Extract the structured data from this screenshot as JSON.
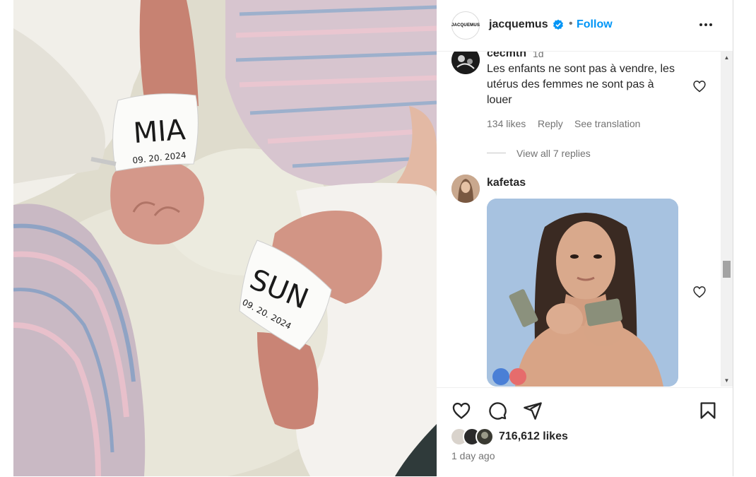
{
  "post": {
    "username": "jacquemus",
    "avatar_text": "JACQUEMUS",
    "follow_label": "Follow",
    "separator": "•",
    "photo_wristbands": [
      "MIA",
      "SUN"
    ],
    "wristband_dates": [
      "09. 20. 2024",
      "09. 20. 2024"
    ],
    "likes": "716,612 likes",
    "posted": "1 day ago"
  },
  "comments": [
    {
      "user": "cecmth",
      "time": "1d",
      "text_lines": [
        "Les enfants ne sont pas à vendre, les",
        "utérus des femmes ne sont pas à",
        "louer"
      ],
      "likes": "134 likes",
      "reply_label": "Reply",
      "translate_label": "See translation",
      "view_replies": "View all 7 replies"
    },
    {
      "user": "kafetas"
    }
  ],
  "icons": {
    "verified": "verified-badge-icon",
    "more": "more-options-icon",
    "like": "heart-icon",
    "comment": "comment-icon",
    "share": "share-icon",
    "save": "bookmark-icon"
  },
  "colors": {
    "link": "#0095f6",
    "verified": "#0095f6",
    "secondary_text": "#737373"
  }
}
